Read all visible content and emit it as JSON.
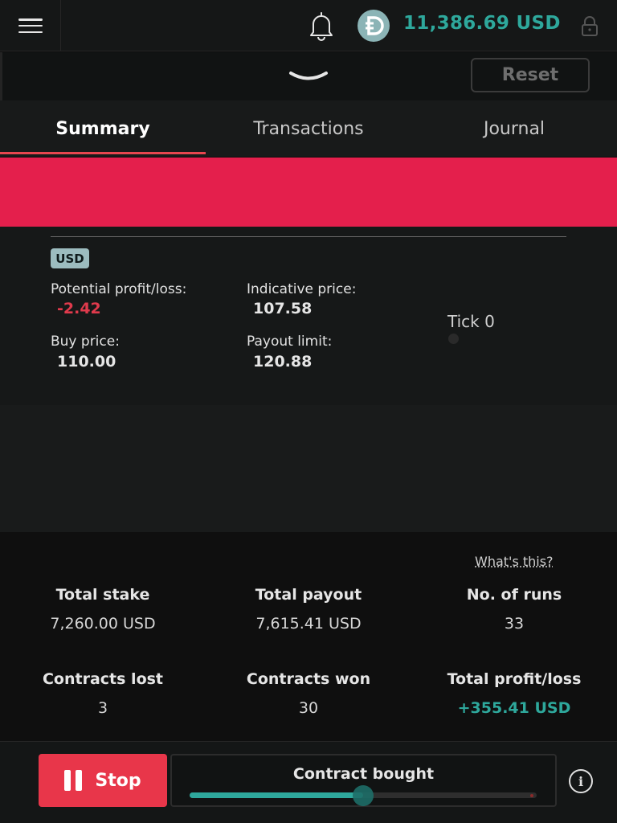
{
  "header": {
    "balance": "11,386.69 USD",
    "colors": {
      "accent": "#2ea89c",
      "danger": "#e8364a",
      "banner": "#e41f4c"
    }
  },
  "toolbar": {
    "reset_label": "Reset"
  },
  "tabs": [
    {
      "label": "Summary",
      "active": true
    },
    {
      "label": "Transactions",
      "active": false
    },
    {
      "label": "Journal",
      "active": false
    }
  ],
  "contract": {
    "currency": "USD",
    "potential_pl_label": "Potential profit/loss:",
    "potential_pl_value": "-2.42",
    "indicative_label": "Indicative price:",
    "indicative_value": "107.58",
    "buy_label": "Buy price:",
    "buy_value": "110.00",
    "payout_label": "Payout limit:",
    "payout_value": "120.88",
    "tick_label": "Tick 0"
  },
  "stats": {
    "whats_this": "What's this?",
    "total_stake_label": "Total stake",
    "total_stake_value": "7,260.00 USD",
    "total_payout_label": "Total payout",
    "total_payout_value": "7,615.41 USD",
    "runs_label": "No. of runs",
    "runs_value": "33",
    "lost_label": "Contracts lost",
    "lost_value": "3",
    "won_label": "Contracts won",
    "won_value": "30",
    "pl_label": "Total profit/loss",
    "pl_value": "+355.41 USD"
  },
  "footer": {
    "stop_label": "Stop",
    "status_label": "Contract bought",
    "progress": 0.5,
    "info_icon": "i"
  }
}
